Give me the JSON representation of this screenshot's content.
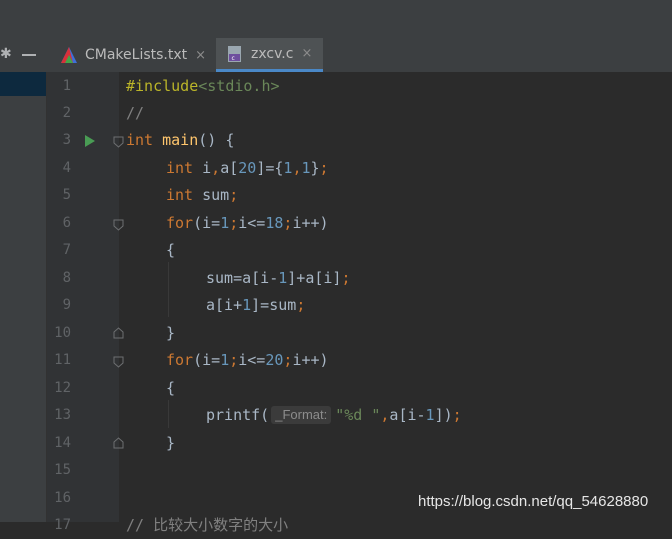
{
  "tabs": [
    {
      "label": "CMakeLists.txt",
      "icon": "cmake-icon",
      "close": "×"
    },
    {
      "label": "zxcv.c",
      "icon": "c-file-icon",
      "close": "×",
      "active": true
    }
  ],
  "toolbar": {
    "gear_icon": "gear-icon",
    "minimize_icon": "minimize-icon"
  },
  "line_numbers": [
    "1",
    "2",
    "3",
    "4",
    "5",
    "6",
    "7",
    "8",
    "9",
    "10",
    "11",
    "12",
    "13",
    "14",
    "15",
    "16",
    "17"
  ],
  "code": {
    "l1_directive": "#include",
    "l1_header": "<stdio.h>",
    "l2_comment": "//",
    "l3_kw": "int",
    "l3_fn": "main",
    "l3_rest": "() {",
    "l4_kw": "int",
    "l4_a": " i",
    "l4_comma": ",",
    "l4_b": "a[",
    "l4_n1": "20",
    "l4_c": "]={",
    "l4_n2": "1",
    "l4_comma2": ",",
    "l4_n3": "1",
    "l4_d": "}",
    "l4_semi": ";",
    "l5_kw": "int",
    "l5_a": " sum",
    "l5_semi": ";",
    "l6_kw": "for",
    "l6_a": "(i=",
    "l6_n1": "1",
    "l6_s1": ";",
    "l6_b": "i<=",
    "l6_n2": "18",
    "l6_s2": ";",
    "l6_c": "i++)",
    "l7": "{",
    "l8_a": "sum=a[i-",
    "l8_n1": "1",
    "l8_b": "]+a[i]",
    "l8_semi": ";",
    "l9_a": "a[i+",
    "l9_n1": "1",
    "l9_b": "]=sum",
    "l9_semi": ";",
    "l10": "}",
    "l11_kw": "for",
    "l11_a": "(i=",
    "l11_n1": "1",
    "l11_s1": ";",
    "l11_b": "i<=",
    "l11_n2": "20",
    "l11_s2": ";",
    "l11_c": "i++)",
    "l12": "{",
    "l13_fn": "printf(",
    "l13_hint": "_Format:",
    "l13_str": "\"%d \"",
    "l13_comma": ",",
    "l13_a": "a[i-",
    "l13_n1": "1",
    "l13_b": "])",
    "l13_semi": ";",
    "l14": "}",
    "l17_partial": "// 比较大小数字的大小"
  },
  "watermark": "https://blog.csdn.net/qq_54628880",
  "colors": {
    "background": "#2b2b2b",
    "keyword": "#cc7832",
    "number": "#6897bb",
    "string": "#6a8759",
    "preprocessor": "#bbb529",
    "comment": "#808080",
    "active_tab_underline": "#4a88c7",
    "run_icon": "#499c54"
  }
}
